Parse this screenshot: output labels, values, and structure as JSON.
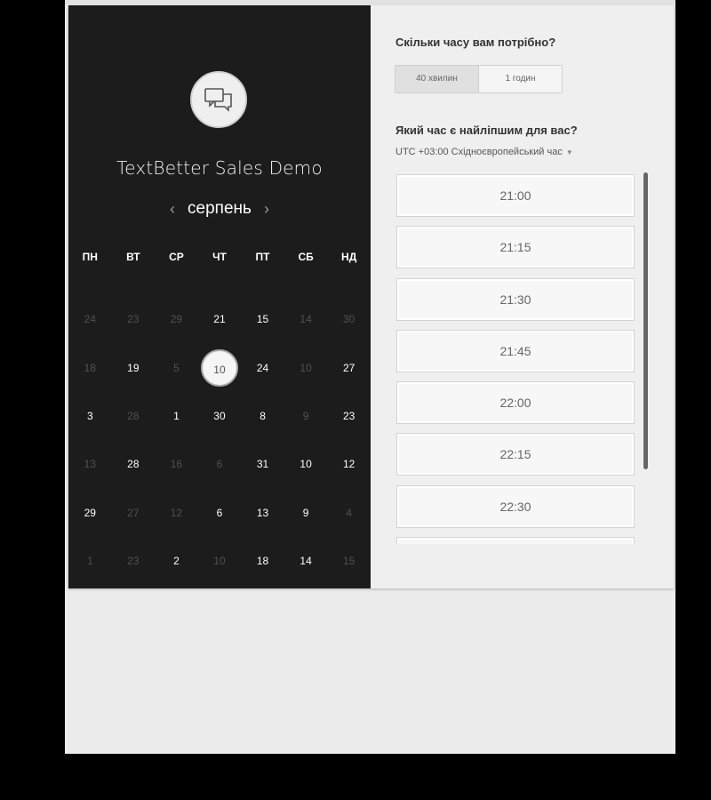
{
  "app": {
    "title": "TextBetter Sales Demo",
    "avatar_icon": "chat-bubbles-icon"
  },
  "calendar": {
    "month": "серпень",
    "prev_icon": "‹",
    "next_icon": "›",
    "weekdays": [
      "ПН",
      "ВТ",
      "СР",
      "ЧТ",
      "ПТ",
      "СБ",
      "НД"
    ],
    "weeks": [
      [
        {
          "d": "24",
          "on": false
        },
        {
          "d": "23",
          "on": false
        },
        {
          "d": "29",
          "on": false
        },
        {
          "d": "21",
          "on": true
        },
        {
          "d": "15",
          "on": true
        },
        {
          "d": "14",
          "on": false
        },
        {
          "d": "30",
          "on": false
        }
      ],
      [
        {
          "d": "18",
          "on": false
        },
        {
          "d": "19",
          "on": true
        },
        {
          "d": "5",
          "on": false
        },
        {
          "d": "10",
          "on": true,
          "selected": true
        },
        {
          "d": "24",
          "on": true
        },
        {
          "d": "10",
          "on": false
        },
        {
          "d": "27",
          "on": true
        }
      ],
      [
        {
          "d": "3",
          "on": true
        },
        {
          "d": "28",
          "on": false
        },
        {
          "d": "1",
          "on": true
        },
        {
          "d": "30",
          "on": true
        },
        {
          "d": "8",
          "on": true
        },
        {
          "d": "9",
          "on": false
        },
        {
          "d": "23",
          "on": true
        }
      ],
      [
        {
          "d": "13",
          "on": false
        },
        {
          "d": "28",
          "on": true
        },
        {
          "d": "16",
          "on": false
        },
        {
          "d": "6",
          "on": false
        },
        {
          "d": "31",
          "on": true
        },
        {
          "d": "10",
          "on": true
        },
        {
          "d": "12",
          "on": true
        }
      ],
      [
        {
          "d": "29",
          "on": true
        },
        {
          "d": "27",
          "on": false
        },
        {
          "d": "12",
          "on": false
        },
        {
          "d": "6",
          "on": true
        },
        {
          "d": "13",
          "on": true
        },
        {
          "d": "9",
          "on": true
        },
        {
          "d": "4",
          "on": false
        }
      ],
      [
        {
          "d": "1",
          "on": false
        },
        {
          "d": "23",
          "on": false
        },
        {
          "d": "2",
          "on": true
        },
        {
          "d": "10",
          "on": false
        },
        {
          "d": "18",
          "on": true
        },
        {
          "d": "14",
          "on": true
        },
        {
          "d": "15",
          "on": false
        }
      ]
    ]
  },
  "booking": {
    "duration_question": "Скільки часу вам потрібно?",
    "durations": [
      {
        "label": "40 хвилин",
        "active": true
      },
      {
        "label": "1 годин",
        "active": false
      }
    ],
    "time_question": "Який час є найліпшим для вас?",
    "timezone": "UTC +03:00 Східноєвропейський час",
    "timezone_caret": "▼",
    "slots": [
      "21:00",
      "21:15",
      "21:30",
      "21:45",
      "22:00",
      "22:15",
      "22:30",
      ""
    ]
  }
}
